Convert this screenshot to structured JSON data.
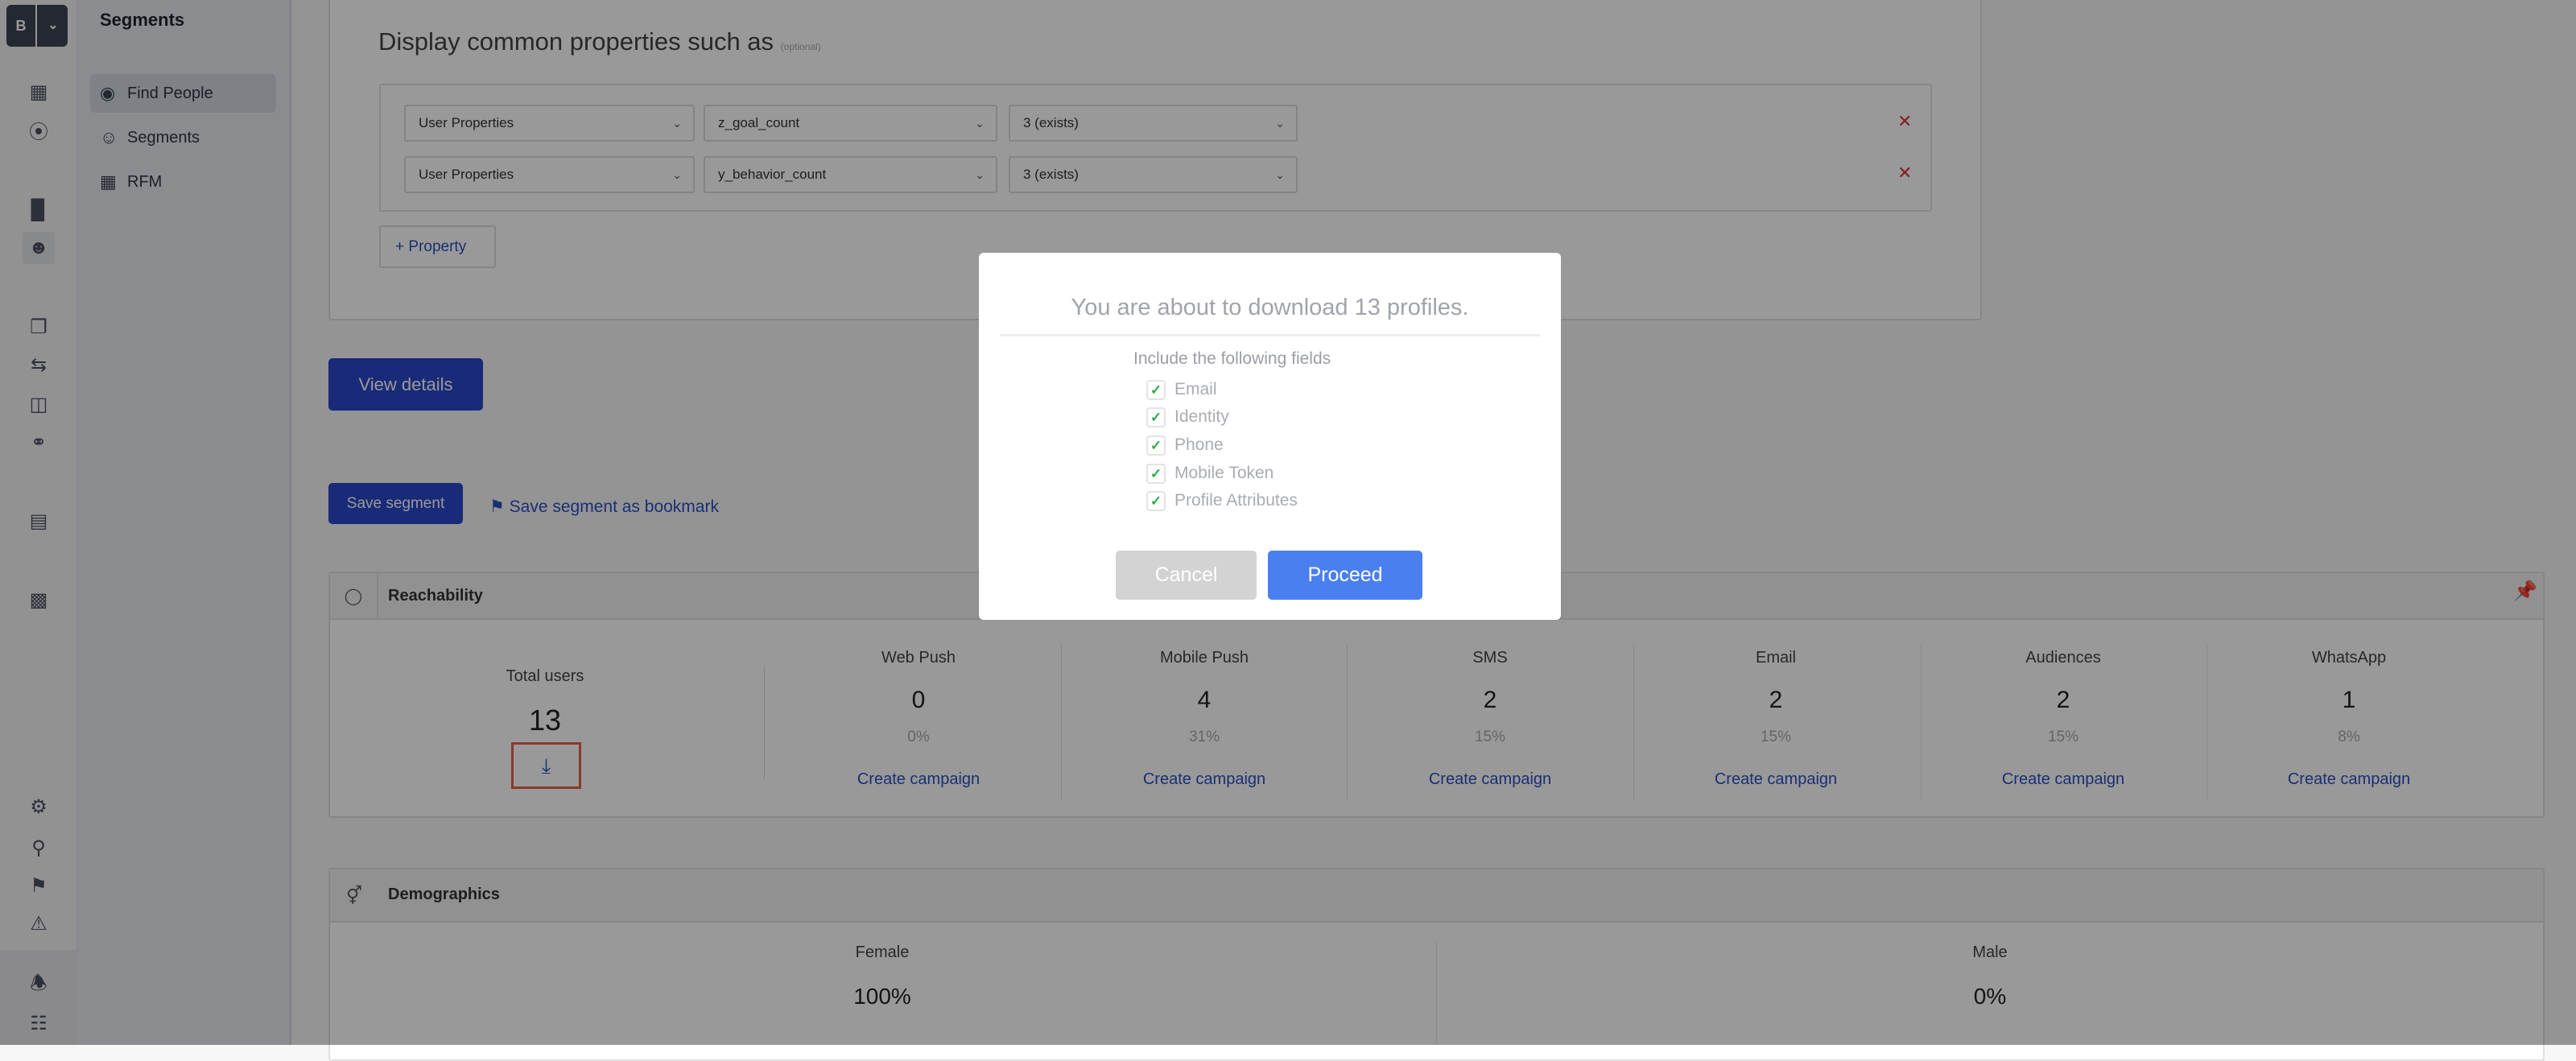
{
  "brand": {
    "initial": "B"
  },
  "rail": {
    "icons": [
      "dashboard-icon",
      "magnet-icon",
      "analytics-icon",
      "people-icon",
      "messages-icon",
      "journeys-icon",
      "campaign-icon",
      "support-icon",
      "catalog-icon",
      "apps-icon",
      "settings-icon",
      "debug-icon",
      "bookmark-flag-icon",
      "alert-icon",
      "bell-icon",
      "org-tree-icon"
    ],
    "active": "people-icon"
  },
  "sidebar": {
    "title": "Segments",
    "items": [
      {
        "label": "Find People",
        "icon": "find-people-icon",
        "active": true
      },
      {
        "label": "Segments",
        "icon": "segments-icon"
      },
      {
        "label": "RFM",
        "icon": "rfm-grid-icon"
      }
    ]
  },
  "properties": {
    "title": "Display common properties such as",
    "optional": "(optional)",
    "rows": [
      {
        "source": "User Properties",
        "property": "z_goal_count",
        "value": "3  (exists)"
      },
      {
        "source": "User Properties",
        "property": "y_behavior_count",
        "value": "3  (exists)"
      }
    ],
    "add_label": "Property"
  },
  "actions": {
    "view_details": "View details",
    "save_segment": "Save segment",
    "save_bookmark": "Save segment as bookmark"
  },
  "reachability": {
    "title": "Reachability",
    "total_label": "Total users",
    "total": "13",
    "channels": [
      {
        "name": "Web Push",
        "count": "0",
        "pct": "0%",
        "link": "Create campaign"
      },
      {
        "name": "Mobile Push",
        "count": "4",
        "pct": "31%",
        "link": "Create campaign"
      },
      {
        "name": "SMS",
        "count": "2",
        "pct": "15%",
        "link": "Create campaign"
      },
      {
        "name": "Email",
        "count": "2",
        "pct": "15%",
        "link": "Create campaign"
      },
      {
        "name": "Audiences",
        "count": "2",
        "pct": "15%",
        "link": "Create campaign"
      },
      {
        "name": "WhatsApp",
        "count": "1",
        "pct": "8%",
        "link": "Create campaign"
      }
    ]
  },
  "demographics": {
    "title": "Demographics",
    "female_label": "Female",
    "female_value": "100%",
    "male_label": "Male",
    "male_value": "0%"
  },
  "modal": {
    "title": "You are about to download 13 profiles.",
    "subtitle": "Include the following fields",
    "fields": [
      {
        "label": "Email",
        "checked": true
      },
      {
        "label": "Identity",
        "checked": true
      },
      {
        "label": "Phone",
        "checked": true
      },
      {
        "label": "Mobile Token",
        "checked": true
      },
      {
        "label": "Profile Attributes",
        "checked": true
      }
    ],
    "cancel": "Cancel",
    "proceed": "Proceed"
  },
  "colors": {
    "primary": "#2847c9",
    "proceed": "#4a7ff0",
    "delete": "#e03535",
    "highlight": "#e8604a",
    "check": "#2eaa4a"
  }
}
